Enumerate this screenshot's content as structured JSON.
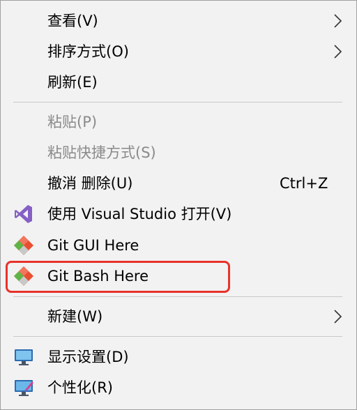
{
  "menu": {
    "items": [
      {
        "label": "查看(V)",
        "submenu": true
      },
      {
        "label": "排序方式(O)",
        "submenu": true
      },
      {
        "label": "刷新(E)"
      },
      {
        "label": "粘贴(P)",
        "disabled": true
      },
      {
        "label": "粘贴快捷方式(S)",
        "disabled": true
      },
      {
        "label": "撤消 删除(U)",
        "shortcut": "Ctrl+Z"
      },
      {
        "label": "使用 Visual Studio 打开(V)",
        "icon": "visual-studio-icon"
      },
      {
        "label": "Git GUI Here",
        "icon": "git-icon"
      },
      {
        "label": "Git Bash Here",
        "icon": "git-icon",
        "highlighted": true
      },
      {
        "label": "新建(W)",
        "submenu": true
      },
      {
        "label": "显示设置(D)",
        "icon": "display-settings-icon"
      },
      {
        "label": "个性化(R)",
        "icon": "personalize-icon"
      }
    ]
  },
  "colors": {
    "menu_background": "#f2f2f2",
    "disabled_text": "#8a8a8a",
    "highlight_border": "#e8322b",
    "visual_studio": "#865fc5",
    "git_red": "#e94e31",
    "git_green": "#5fb446"
  }
}
